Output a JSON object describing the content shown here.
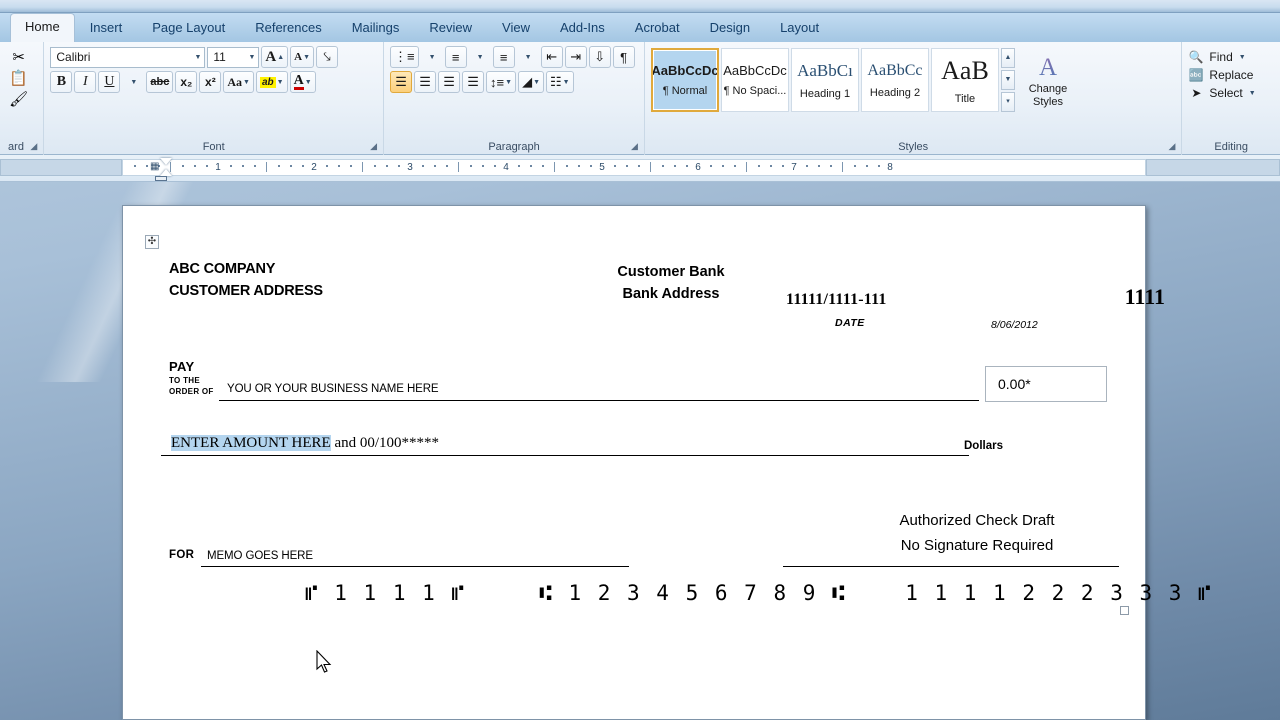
{
  "ribbon": {
    "tabs": [
      {
        "label": "Home",
        "active": true
      },
      {
        "label": "Insert",
        "active": false
      },
      {
        "label": "Page Layout",
        "active": false
      },
      {
        "label": "References",
        "active": false
      },
      {
        "label": "Mailings",
        "active": false
      },
      {
        "label": "Review",
        "active": false
      },
      {
        "label": "View",
        "active": false
      },
      {
        "label": "Add-Ins",
        "active": false
      },
      {
        "label": "Acrobat",
        "active": false
      },
      {
        "label": "Design",
        "active": false
      },
      {
        "label": "Layout",
        "active": false
      }
    ],
    "groups": {
      "clipboard": {
        "label": "ard",
        "icons": [
          "cut-scissors-icon",
          "copy-icon",
          "format-painter-icon"
        ]
      },
      "font": {
        "label": "Font",
        "font_name": "Calibri",
        "font_size": "11",
        "buttons": [
          "grow-font",
          "shrink-font",
          "clear-formatting",
          "bold",
          "italic",
          "underline",
          "strikethrough",
          "subscript",
          "superscript",
          "change-case",
          "text-highlight-color",
          "font-color"
        ]
      },
      "paragraph": {
        "label": "Paragraph",
        "buttons": [
          "bullets",
          "numbering",
          "multilevel-list",
          "decrease-indent",
          "increase-indent",
          "sort",
          "show-formatting-marks",
          "align-left",
          "align-center",
          "align-right",
          "justify",
          "line-spacing",
          "shading",
          "borders"
        ]
      },
      "styles": {
        "label": "Styles",
        "items": [
          {
            "preview": "AaBbCcDc",
            "name": "¶ Normal",
            "selected": true
          },
          {
            "preview": "AaBbCcDc",
            "name": "¶ No Spaci...",
            "selected": false
          },
          {
            "preview": "AaBbCı",
            "name": "Heading 1",
            "selected": false
          },
          {
            "preview": "AaBbCc",
            "name": "Heading 2",
            "selected": false
          },
          {
            "preview": "AaB",
            "name": "Title",
            "selected": false
          }
        ],
        "change_styles_label": "Change\nStyles"
      },
      "editing": {
        "label": "Editing",
        "items": [
          {
            "label": "Find",
            "icon": "binoculars-icon",
            "caret": true
          },
          {
            "label": "Replace",
            "icon": "replace-icon",
            "caret": false
          },
          {
            "label": "Select",
            "icon": "pointer-icon",
            "caret": true
          }
        ]
      }
    }
  },
  "ruler": {
    "numbers": [
      "1",
      "2",
      "3",
      "4",
      "5",
      "6",
      "7",
      "8"
    ]
  },
  "document": {
    "check": {
      "company_name": "ABC COMPANY",
      "company_address": "CUSTOMER ADDRESS",
      "bank_name": "Customer Bank",
      "bank_address": "Bank Address",
      "routing_fraction": "11111/1111-111",
      "check_number": "1111",
      "date_label": "DATE",
      "date_value": "8/06/2012",
      "pay_label": "PAY",
      "to_the_label": "TO THE",
      "order_of_label": "ORDER OF",
      "payee": "YOU OR YOUR BUSINESS NAME HERE",
      "amount_box_value": "0.00*",
      "amount_words_selected": "ENTER AMOUNT HERE",
      "amount_words_rest": " and 00/100*****",
      "dollars_label": "Dollars",
      "authorized_line1": "Authorized Check Draft",
      "authorized_line2": "No Signature Required",
      "for_label": "FOR",
      "memo": "MEMO GOES HERE",
      "micr_line": "⑈ 1 1 1 1 ⑈     ⑆ 1 2 3 4 5 6 7 8 9 ⑆    1 1 1 1 2 2 2 3 3 3 ⑈"
    }
  }
}
